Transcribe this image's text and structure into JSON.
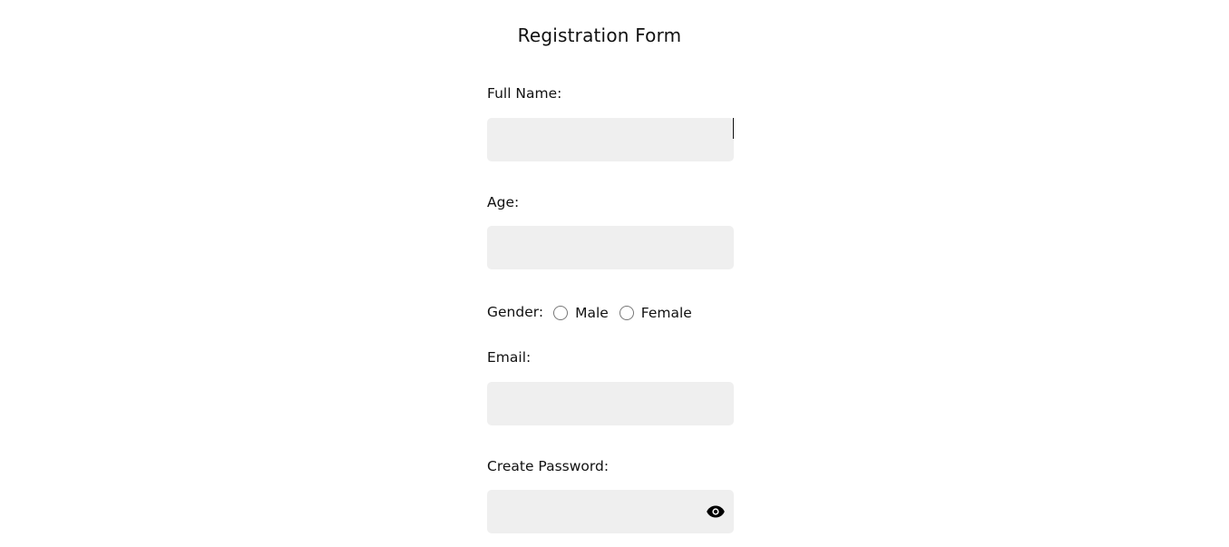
{
  "form": {
    "title": "Registration Form",
    "full_name": {
      "label": "Full Name:",
      "value": ""
    },
    "age": {
      "label": "Age:",
      "value": ""
    },
    "gender": {
      "label": "Gender:",
      "options": [
        {
          "label": "Male",
          "checked": false
        },
        {
          "label": "Female",
          "checked": false
        }
      ]
    },
    "email": {
      "label": "Email:",
      "value": ""
    },
    "password": {
      "label": "Create Password:",
      "value": "",
      "toggle_icon": "eye-icon"
    }
  }
}
